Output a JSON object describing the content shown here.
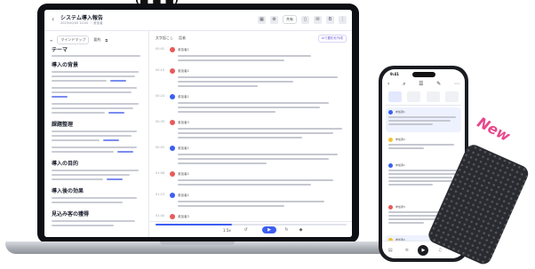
{
  "page_header": {
    "fragment": "(■ ■ ■)"
  },
  "laptop": {
    "meeting_title": "システム導入報告",
    "meeting_meta": "2023/00/00 10:00 ・ 参加者",
    "header_share": "共有",
    "left_toolbar": {
      "view": "マインドマップ",
      "mode": "要約"
    },
    "sections": [
      {
        "title": "テーマ"
      },
      {
        "title": "導入の背景"
      },
      {
        "title": "課題整理"
      },
      {
        "title": "導入の目的"
      },
      {
        "title": "導入後の効果"
      },
      {
        "title": "見込み客の獲得"
      }
    ],
    "right_toolbar": {
      "tab1": "文字起こし",
      "tab2": "話者"
    },
    "right_badge": "AIで要約を作成",
    "messages": [
      {
        "time": "00:01",
        "speaker": "参加者1",
        "avatar_color": "#e85a5a"
      },
      {
        "time": "00:15",
        "speaker": "参加者2",
        "avatar_color": "#e85a5a"
      },
      {
        "time": "00:24",
        "speaker": "参加者1",
        "avatar_color": "#3d5ef0"
      },
      {
        "time": "00:35",
        "speaker": "参加者3",
        "avatar_color": "#e85a5a"
      },
      {
        "time": "00:52",
        "speaker": "参加者1",
        "avatar_color": "#3d5ef0"
      },
      {
        "time": "01:08",
        "speaker": "参加者2",
        "avatar_color": "#e85a5a"
      },
      {
        "time": "01:23",
        "speaker": "参加者1",
        "avatar_color": "#3d5ef0"
      },
      {
        "time": "01:40",
        "speaker": "参加者3",
        "avatar_color": "#e85a5a"
      }
    ],
    "player": {
      "speed": "1.5x",
      "progress_fraction": 0.4
    }
  },
  "phone": {
    "status_time": "9:41",
    "messages": [
      {
        "speaker": "参加者1",
        "avatar_color": "#3d5ef0",
        "highlight": true
      },
      {
        "speaker": "参加者2",
        "avatar_color": "#f2c230",
        "highlight": false
      },
      {
        "speaker": "参加者1",
        "avatar_color": "#3d5ef0",
        "highlight": false
      },
      {
        "speaker": "参加者3",
        "avatar_color": "#e85a5a",
        "highlight": false
      },
      {
        "speaker": "参加者2",
        "avatar_color": "#f2c230",
        "highlight": true
      }
    ],
    "nav": [
      "▤",
      "≡",
      "▶",
      "♫",
      "⋯"
    ]
  },
  "promo": {
    "new_label": "New"
  },
  "colors": {
    "accent": "#3d5ef0",
    "promo_pink": "#e8468a"
  }
}
